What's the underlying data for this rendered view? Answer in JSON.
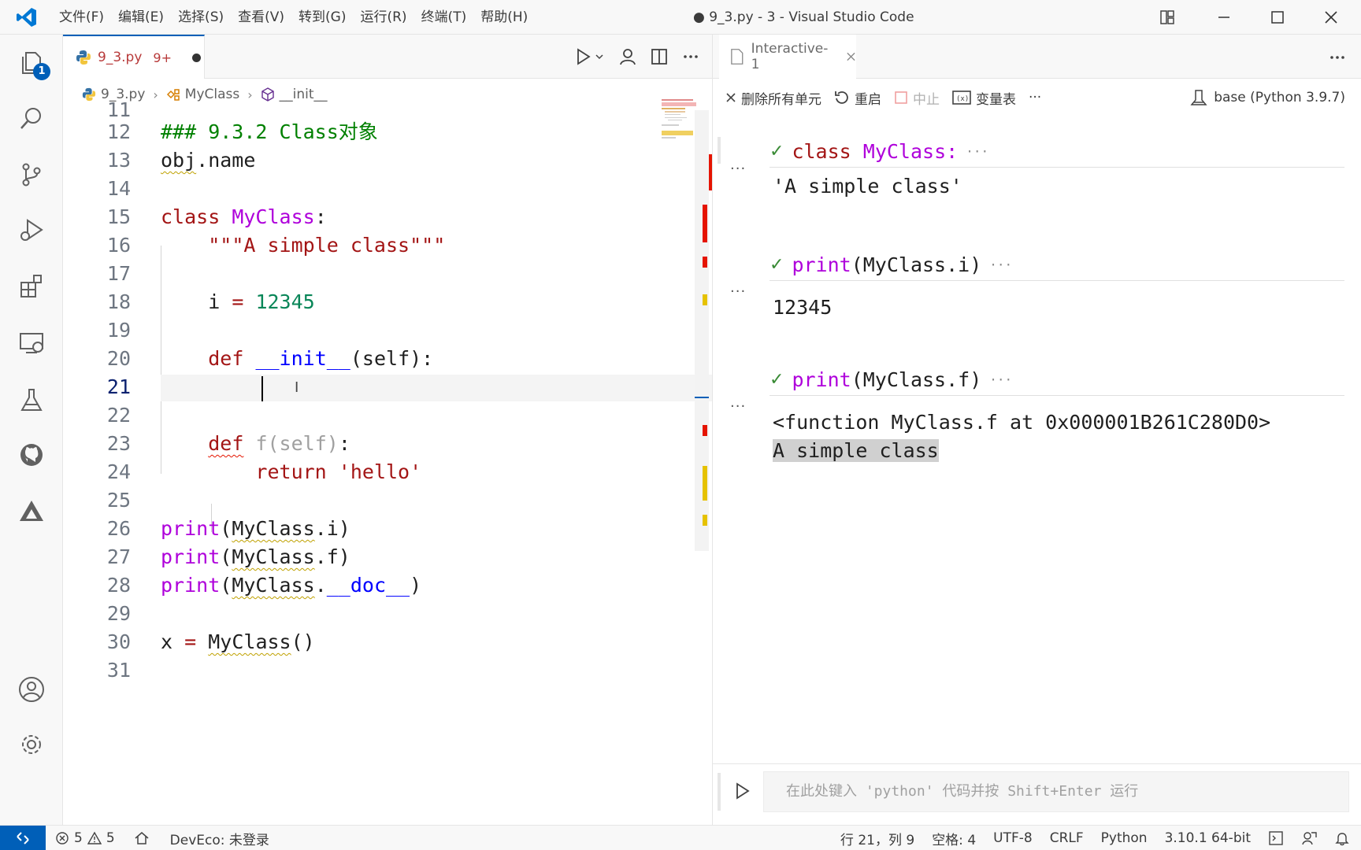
{
  "titlebar": {
    "menus": [
      "文件(F)",
      "编辑(E)",
      "选择(S)",
      "查看(V)",
      "转到(G)",
      "运行(R)",
      "终端(T)",
      "帮助(H)"
    ],
    "title": "● 9_3.py - 3 - Visual Studio Code"
  },
  "activity": {
    "explorer_badge": "1"
  },
  "editor": {
    "tab": {
      "name": "9_3.py",
      "problems": "9+"
    },
    "breadcrumb": {
      "file": "9_3.py",
      "class": "MyClass",
      "member": "__init__"
    },
    "line_numbers": [
      "11",
      "12",
      "13",
      "14",
      "15",
      "16",
      "17",
      "18",
      "19",
      "20",
      "21",
      "22",
      "23",
      "24",
      "25",
      "26",
      "27",
      "28",
      "29",
      "30",
      "31"
    ],
    "active_line": "21"
  },
  "interactive": {
    "tab": "Interactive-1",
    "toolbar": {
      "clear_all": "删除所有单元",
      "restart": "重启",
      "interrupt": "中止",
      "variables": "变量表",
      "more": "···"
    },
    "kernel": "base (Python 3.9.7)",
    "cells": [
      {
        "code_kw": "class",
        "code_rest": "MyClass:",
        "output": [
          "'A simple class'"
        ]
      },
      {
        "code_fn": "print",
        "code_rest": "(MyClass.i)",
        "output": [
          "12345"
        ]
      },
      {
        "code_fn": "print",
        "code_rest": "(MyClass.f)",
        "output": [
          "<function MyClass.f at 0x000001B261C280D0>",
          "A simple class"
        ]
      }
    ],
    "input_placeholder": "在此处键入 'python' 代码并按 Shift+Enter 运行"
  },
  "statusbar": {
    "errors": "5",
    "warnings": "5",
    "deveco": "DevEco: 未登录",
    "position": "行 21，列 9",
    "spaces": "空格: 4",
    "encoding": "UTF-8",
    "eol": "CRLF",
    "language": "Python",
    "interpreter": "3.10.1 64-bit"
  },
  "colors": {
    "accent": "#005fb8",
    "keyword": "#af00db",
    "error": "#e51400"
  }
}
